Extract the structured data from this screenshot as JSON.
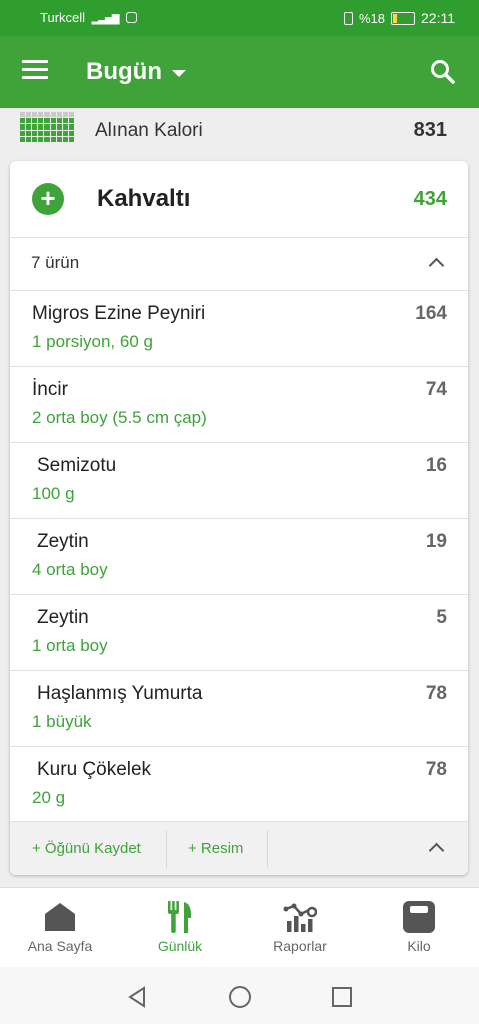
{
  "status": {
    "carrier": "Turkcell",
    "battery": "%18",
    "battery_fraction": 0.18,
    "time": "22:11"
  },
  "appbar": {
    "title": "Bugün"
  },
  "calories": {
    "label": "Alınan Kalori",
    "value": "831"
  },
  "meal": {
    "name": "Kahvaltı",
    "calories": "434",
    "count_label": "7 ürün",
    "items": [
      {
        "name": "Migros Ezine Peyniri",
        "portion": "1 porsiyon, 60 g",
        "kcal": "164"
      },
      {
        "name": "İncir",
        "portion": "2 orta boy (5.5 cm çap)",
        "kcal": "74"
      },
      {
        "name": "Semizotu",
        "portion": "100 g",
        "kcal": "16"
      },
      {
        "name": "Zeytin",
        "portion": "4 orta boy",
        "kcal": "19"
      },
      {
        "name": "Zeytin",
        "portion": "1 orta boy",
        "kcal": "5"
      },
      {
        "name": "Haşlanmış Yumurta",
        "portion": "1 büyük",
        "kcal": "78"
      },
      {
        "name": "Kuru Çökelek",
        "portion": "20 g",
        "kcal": "78"
      }
    ],
    "save_label": "+ Öğünü Kaydet",
    "photo_label": "+ Resim"
  },
  "nav": {
    "tabs": [
      {
        "label": "Ana Sayfa",
        "icon": "home-icon"
      },
      {
        "label": "Günlük",
        "icon": "fork-knife-icon"
      },
      {
        "label": "Raporlar",
        "icon": "reports-icon"
      },
      {
        "label": "Kilo",
        "icon": "scale-icon"
      }
    ],
    "active": "Günlük"
  },
  "colors": {
    "primary": "#3fa33a",
    "statusbar": "#2f9e2f"
  }
}
